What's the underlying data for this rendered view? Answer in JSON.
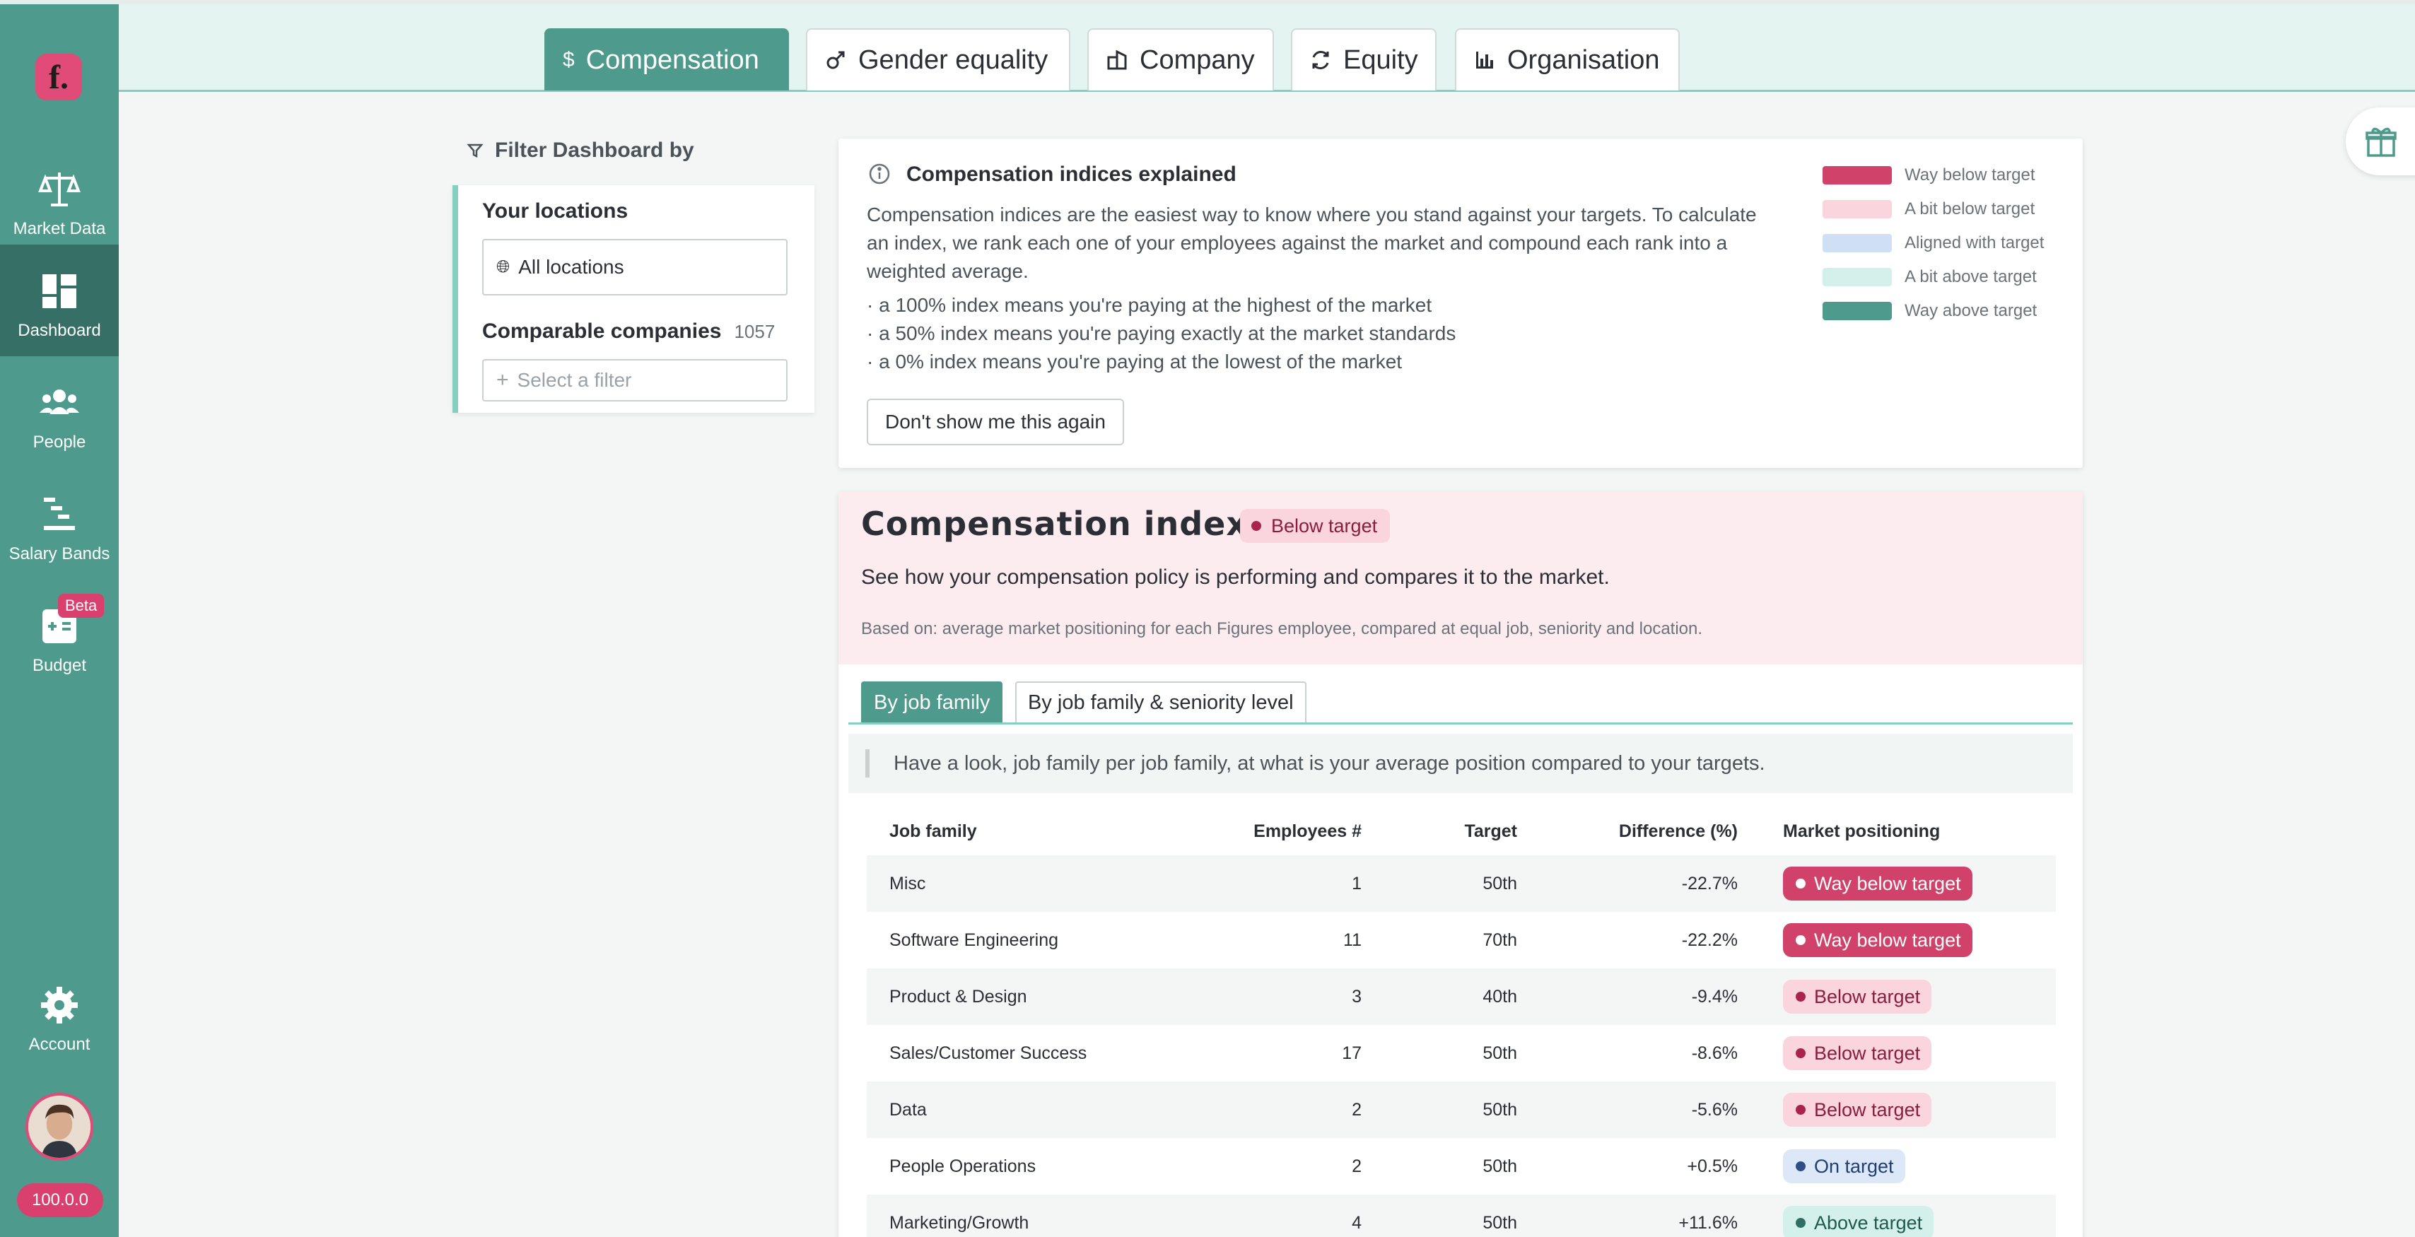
{
  "sidebar": {
    "logo_letter": "f.",
    "items": [
      {
        "label": "Market Data",
        "icon": "scales-icon"
      },
      {
        "label": "Dashboard",
        "icon": "dashboard-icon"
      },
      {
        "label": "People",
        "icon": "people-icon"
      },
      {
        "label": "Salary Bands",
        "icon": "salary-bands-icon"
      },
      {
        "label": "Budget",
        "icon": "budget-icon",
        "badge": "Beta"
      },
      {
        "label": "Account",
        "icon": "gear-icon"
      }
    ],
    "version": "100.0.0"
  },
  "tabs": [
    {
      "label": "Compensation",
      "icon": "dollar-icon"
    },
    {
      "label": "Gender equality",
      "icon": "gender-icon"
    },
    {
      "label": "Company",
      "icon": "building-icon"
    },
    {
      "label": "Equity",
      "icon": "equity-icon"
    },
    {
      "label": "Organisation",
      "icon": "bar-chart-icon"
    }
  ],
  "filter": {
    "title": "Filter Dashboard by",
    "locations_label": "Your locations",
    "locations_value": "All locations",
    "comparable_label": "Comparable companies",
    "comparable_count": "1057",
    "filter_placeholder": "Select a filter"
  },
  "explainer": {
    "title": "Compensation indices explained",
    "body": "Compensation indices are the easiest way to know where you stand against your targets. To calculate an index, we rank each one of your employees against the market and compound each rank into a weighted average.",
    "bullets": [
      "· a 100% index means you're paying at the highest of the market",
      "· a 50% index means you're paying exactly at the market standards",
      "· a 0% index means you're paying at the lowest of the market"
    ],
    "button": "Don't show me this again",
    "legend": [
      {
        "label": "Way below target",
        "color": "#d1426b"
      },
      {
        "label": "A bit below target",
        "color": "#fbd5de"
      },
      {
        "label": "Aligned with target",
        "color": "#cfe0f5"
      },
      {
        "label": "A bit above target",
        "color": "#d3f0ea"
      },
      {
        "label": "Way above target",
        "color": "#4e9a8c"
      }
    ]
  },
  "index": {
    "title": "Compensation index",
    "status": "Below target",
    "subtitle": "See how your compensation policy is performing and compares it to the market.",
    "based_on": "Based on: average market positioning for each Figures employee, compared at equal job, seniority and location.",
    "subtabs": [
      "By job family",
      "By job family & seniority level"
    ],
    "note": "Have a look, job family per job family, at what is your average position compared to your targets.",
    "columns": [
      "Job family",
      "Employees #",
      "Target",
      "Difference (%)",
      "Market positioning"
    ],
    "rows": [
      {
        "family": "Misc",
        "employees": "1",
        "target": "50th",
        "diff": "-22.7%",
        "position": "Way below target",
        "kind": "way-below"
      },
      {
        "family": "Software Engineering",
        "employees": "11",
        "target": "70th",
        "diff": "-22.2%",
        "position": "Way below target",
        "kind": "way-below"
      },
      {
        "family": "Product & Design",
        "employees": "3",
        "target": "40th",
        "diff": "-9.4%",
        "position": "Below target",
        "kind": "below"
      },
      {
        "family": "Sales/Customer Success",
        "employees": "17",
        "target": "50th",
        "diff": "-8.6%",
        "position": "Below target",
        "kind": "below"
      },
      {
        "family": "Data",
        "employees": "2",
        "target": "50th",
        "diff": "-5.6%",
        "position": "Below target",
        "kind": "below"
      },
      {
        "family": "People Operations",
        "employees": "2",
        "target": "50th",
        "diff": "+0.5%",
        "position": "On target",
        "kind": "on"
      },
      {
        "family": "Marketing/Growth",
        "employees": "4",
        "target": "50th",
        "diff": "+11.6%",
        "position": "Above target",
        "kind": "above"
      }
    ]
  },
  "colors": {
    "sidebar": "#4e9a8c",
    "sidebar_active": "#356f65",
    "brand_pink": "#e04b78",
    "way_below": "#d1426b",
    "below": "#fbd5de",
    "on": "#dce8f8",
    "above": "#d3f0ea"
  }
}
